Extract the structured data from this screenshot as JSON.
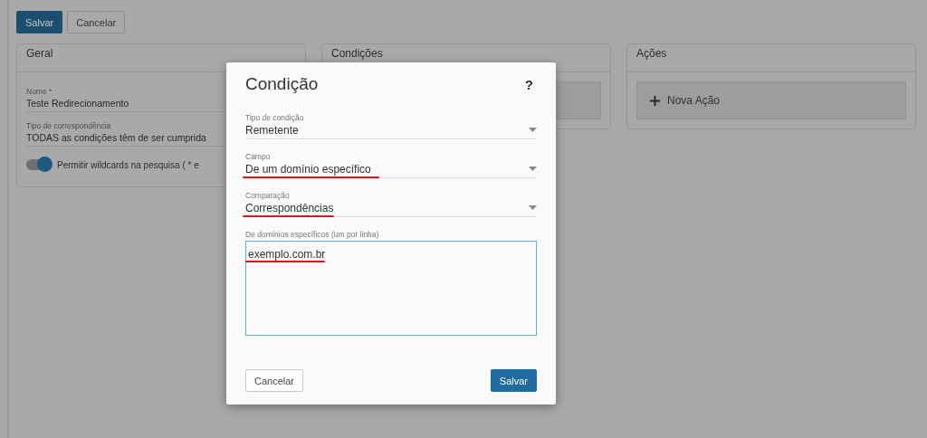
{
  "toolbar": {
    "buttons": [
      {
        "label": "Salvar",
        "kind": "primary"
      },
      {
        "label": "Cancelar",
        "kind": "secondary"
      }
    ]
  },
  "cards": [
    {
      "title": "Geral",
      "kind": "form",
      "fields": [
        {
          "label": "Nome *",
          "value": "Teste Redirecionamento"
        },
        {
          "label": "Tipo de correspondência",
          "value": "TODAS as condições têm de ser cumprida"
        }
      ],
      "toggle": {
        "label": "Permitir wildcards na pesquisa ( * e",
        "on": true
      }
    },
    {
      "title": "Condições",
      "kind": "list"
    },
    {
      "title": "Ações",
      "kind": "list",
      "add_button": "Nova Ação"
    }
  ],
  "dialog": {
    "title": "Condição",
    "help": "?",
    "selects": [
      {
        "label": "Tipo de condição",
        "value": "Remetente",
        "highlighted": false
      },
      {
        "label": "Campo",
        "value": "De um domínio específico",
        "highlighted": true
      },
      {
        "label": "Comparação",
        "value": "Correspondências",
        "highlighted": true
      }
    ],
    "textarea": {
      "label": "De domínios específicos (um por linha)",
      "value": "exemplo.com.br",
      "highlighted": true
    },
    "buttons": [
      {
        "label": "Cancelar",
        "kind": "secondary"
      },
      {
        "label": "Salvar",
        "kind": "primary"
      }
    ]
  }
}
